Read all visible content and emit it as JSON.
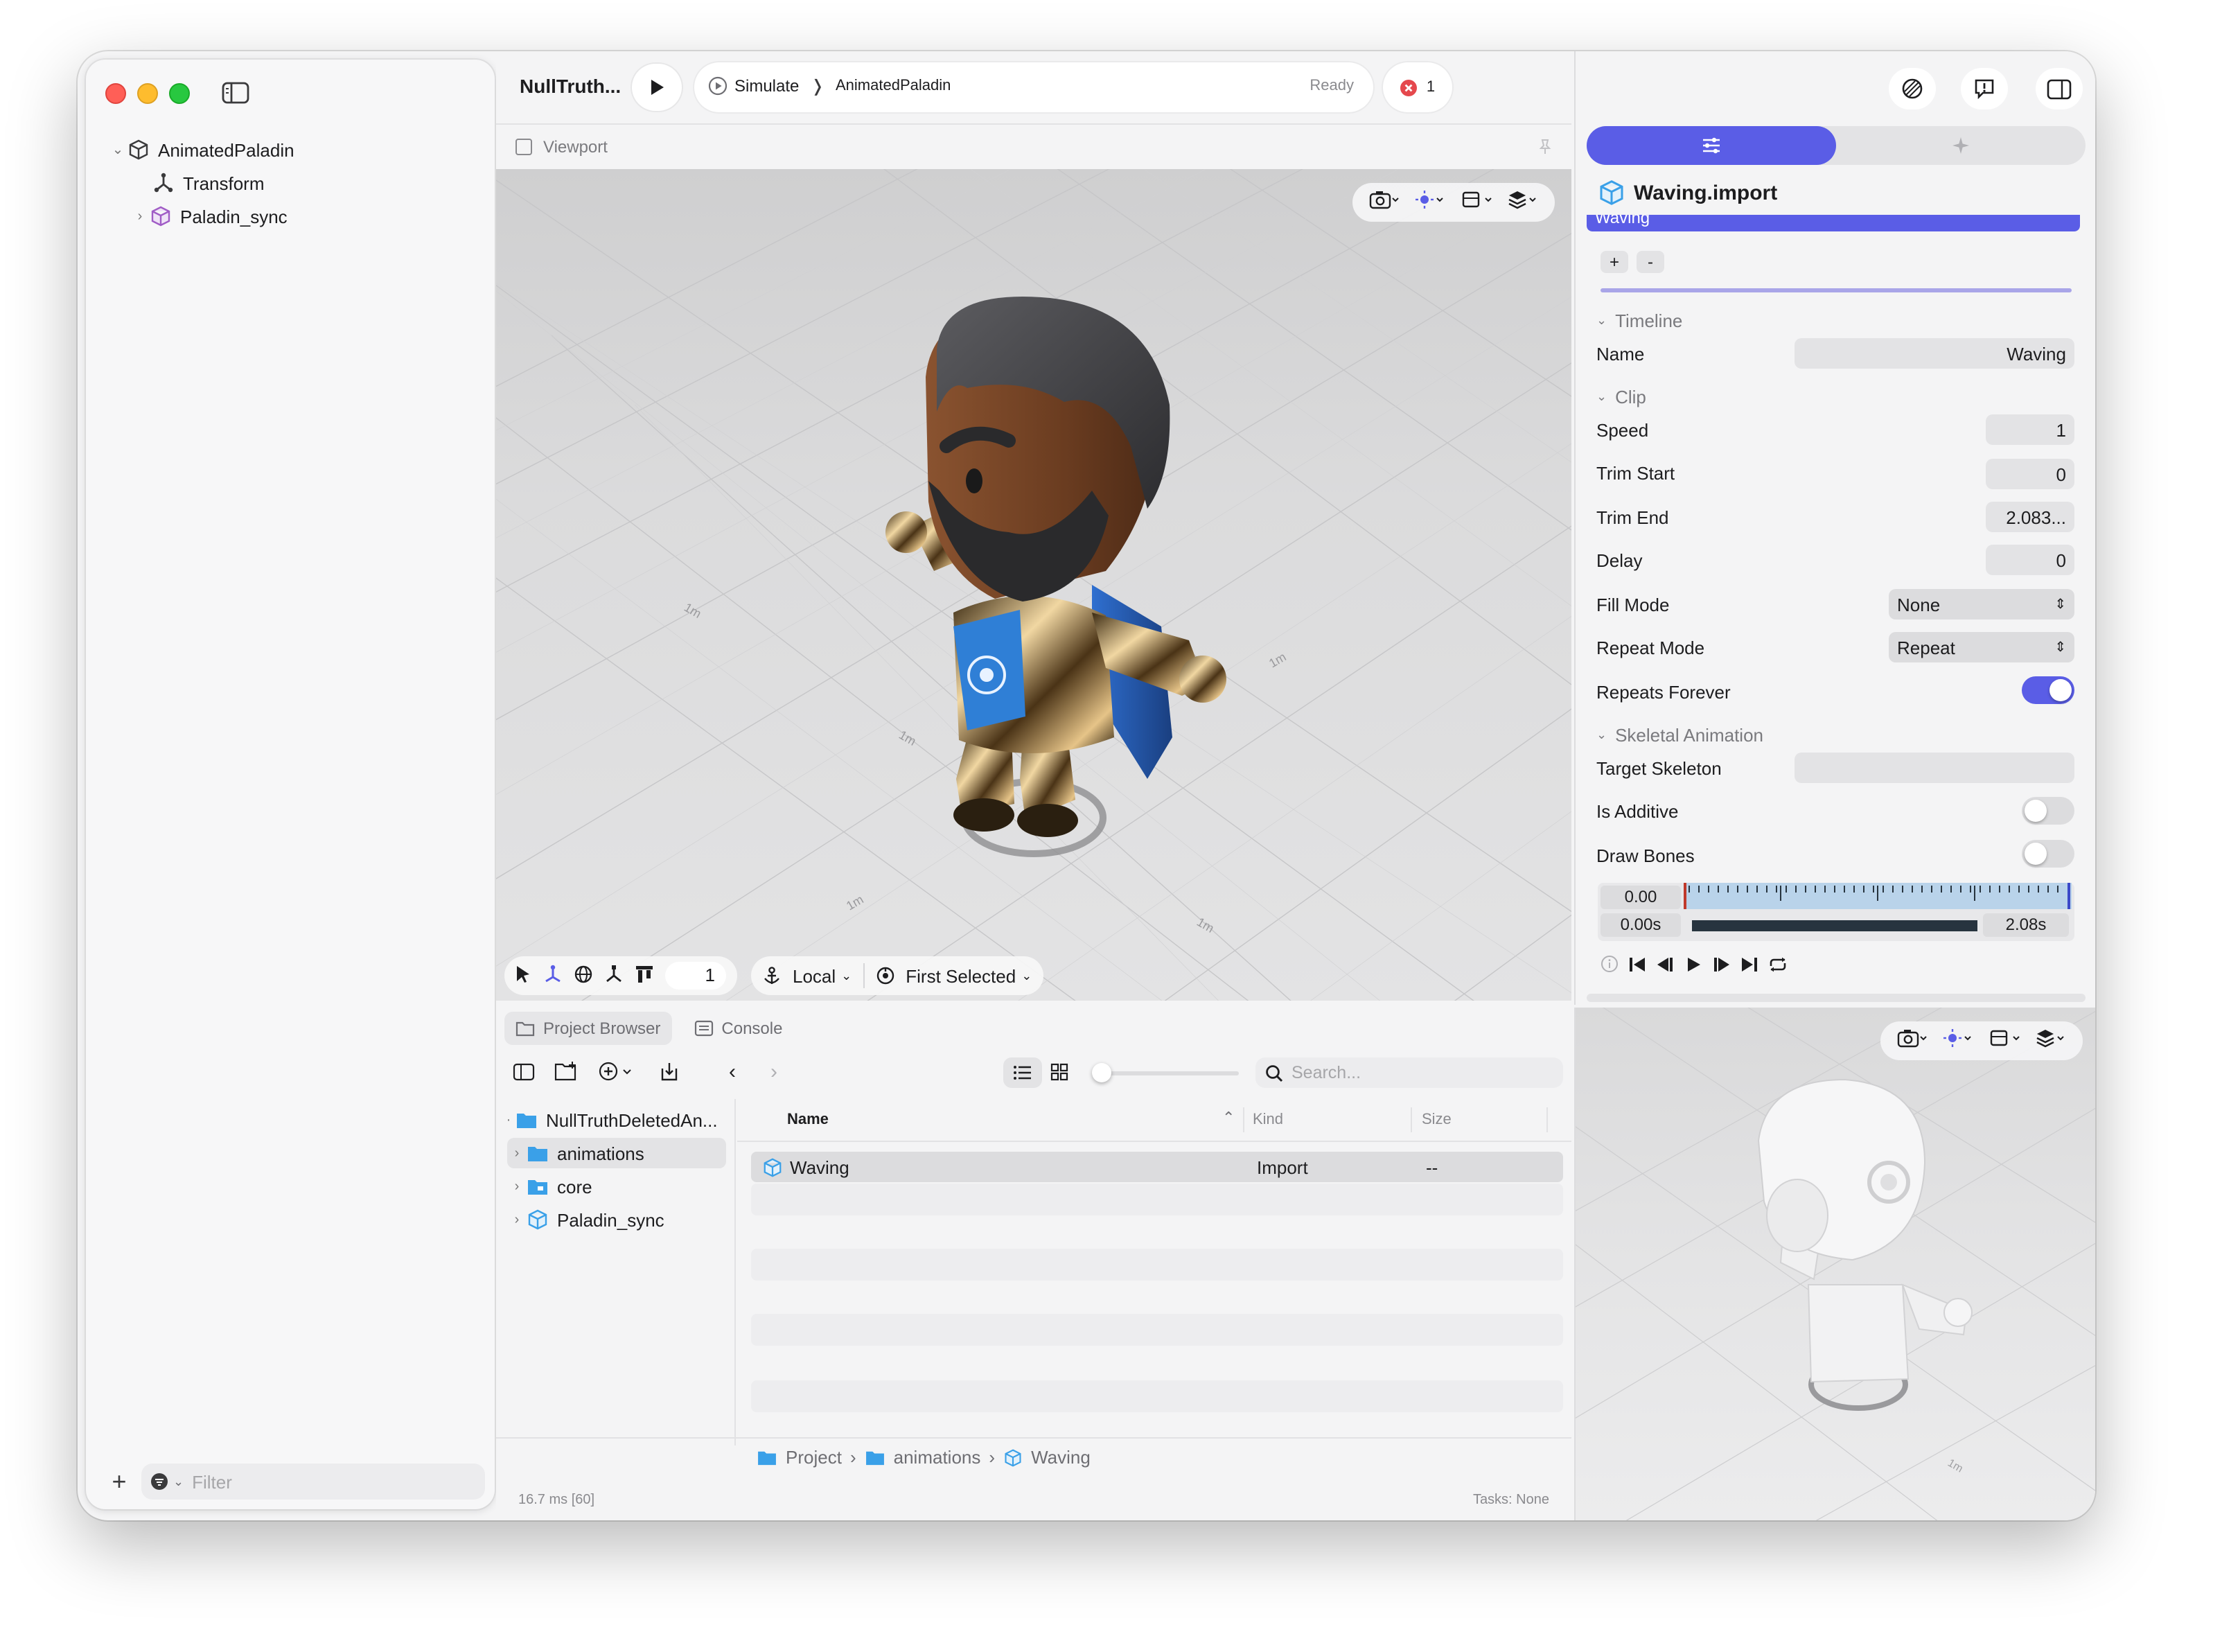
{
  "window": {
    "project_title": "NullTruth...",
    "scheme": "Simulate",
    "target": "AnimatedPaladin",
    "status": "Ready",
    "error_count": "1"
  },
  "sidebar": {
    "tree": [
      {
        "label": "AnimatedPaladin",
        "icon": "cube-icon"
      },
      {
        "label": "Transform",
        "icon": "transform-icon"
      },
      {
        "label": "Paladin_sync",
        "icon": "model-icon"
      }
    ],
    "filter_placeholder": "Filter"
  },
  "viewport": {
    "header_label": "Viewport",
    "frame_value": "1",
    "space_label": "Local",
    "pivot_label": "First Selected",
    "grid_labels": [
      "1m",
      "1m",
      "1m",
      "1m",
      "1m"
    ]
  },
  "bottom_panel": {
    "tabs": [
      "Project Browser",
      "Console"
    ],
    "search_placeholder": "Search...",
    "folders": [
      {
        "label": "NullTruthDeletedAn..."
      },
      {
        "label": "animations"
      },
      {
        "label": "core"
      },
      {
        "label": "Paladin_sync"
      }
    ],
    "columns": [
      "Name",
      "Kind",
      "Size"
    ],
    "files": [
      {
        "name": "Waving",
        "kind": "Import",
        "size": "--"
      }
    ],
    "breadcrumb": [
      "Project",
      "animations",
      "Waving"
    ],
    "frame_time": "16.7 ms [60]",
    "tasks": "Tasks: None"
  },
  "inspector": {
    "title": "Waving.import",
    "selected_animation": "Waving",
    "add_label": "+",
    "remove_label": "-",
    "timeline_section": "Timeline",
    "name_label": "Name",
    "name_value": "Waving",
    "clip_section": "Clip",
    "speed_label": "Speed",
    "speed_value": "1",
    "trim_start_label": "Trim Start",
    "trim_start_value": "0",
    "trim_end_label": "Trim End",
    "trim_end_value": "2.083...",
    "delay_label": "Delay",
    "delay_value": "0",
    "fill_mode_label": "Fill Mode",
    "fill_mode_value": "None",
    "repeat_mode_label": "Repeat Mode",
    "repeat_mode_value": "Repeat",
    "repeats_forever_label": "Repeats Forever",
    "repeats_forever": true,
    "skeletal_section": "Skeletal Animation",
    "target_skeleton_label": "Target Skeleton",
    "target_skeleton_value": "",
    "is_additive_label": "Is Additive",
    "is_additive": false,
    "draw_bones_label": "Draw Bones",
    "draw_bones": false,
    "scrub_time": "0.00",
    "range_start": "0.00s",
    "range_end": "2.08s"
  },
  "colors": {
    "accent": "#5a5de6",
    "folder": "#3aa0e8",
    "error": "#e5484d"
  }
}
